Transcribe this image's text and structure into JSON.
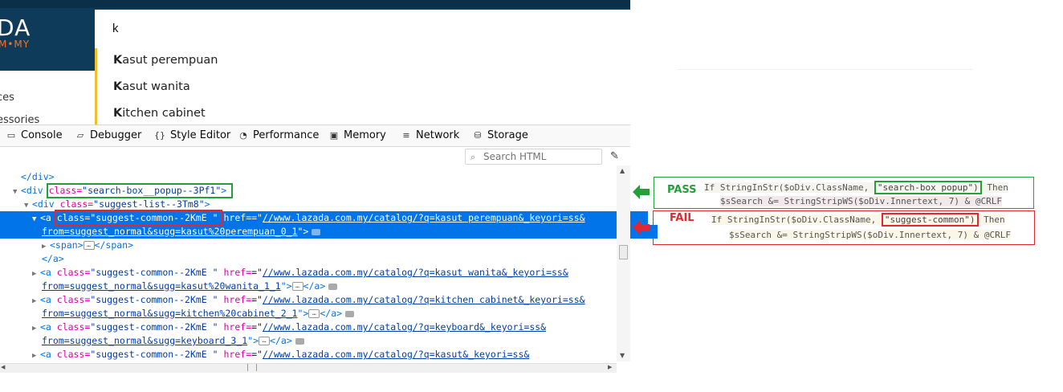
{
  "site": {
    "logo": "DA",
    "logo_sub": "M•MY",
    "categories": [
      "ces",
      "essories"
    ]
  },
  "search": {
    "value": "k",
    "suggestions": [
      {
        "hl": "K",
        "rest": "asut perempuan"
      },
      {
        "hl": "K",
        "rest": "asut wanita"
      },
      {
        "hl": "K",
        "rest": "itchen cabinet"
      }
    ]
  },
  "devtools": {
    "tabs": [
      {
        "icon": "console-icon",
        "label": "Console"
      },
      {
        "icon": "debugger-icon",
        "label": "Debugger"
      },
      {
        "icon": "style-editor-icon",
        "label": "Style Editor"
      },
      {
        "icon": "performance-icon",
        "label": "Performance"
      },
      {
        "icon": "memory-icon",
        "label": "Memory"
      },
      {
        "icon": "network-icon",
        "label": "Network"
      },
      {
        "icon": "storage-icon",
        "label": "Storage"
      }
    ],
    "search_placeholder": "Search HTML"
  },
  "markup": {
    "l0": "</div>",
    "l1_tag": "<div ",
    "l1_attr": "class=",
    "l1_val": "\"search-box__popup--3Pf1\"",
    "l1_end": ">",
    "l2_tag": "<div ",
    "l2_attr": "class=",
    "l2_val": "\"suggest-list--3Tm8\"",
    "l2_end": ">",
    "l3_tag": "<a ",
    "l3_attr": "class=",
    "l3_val": "\"suggest-common--2KmE \"",
    "l3_attr2": " href=",
    "l3_url": "//www.lazada.com.my/catalog/?q=kasut perempuan&_keyori=ss&",
    "l3b_url": "from=suggest_normal&sugg=kasut%20perempuan_0_1",
    "l3b_end": "\">",
    "l4": "<span>",
    "l4_end": "</span>",
    "l5": "</a>",
    "rows": [
      {
        "url": "//www.lazada.com.my/catalog/?q=kasut wanita&_keyori=ss&",
        "url2": "from=suggest_normal&sugg=kasut%20wanita_1_1"
      },
      {
        "url": "//www.lazada.com.my/catalog/?q=kitchen cabinet&_keyori=ss&",
        "url2": "from=suggest_normal&sugg=kitchen%20cabinet_2_1"
      },
      {
        "url": "//www.lazada.com.my/catalog/?q=keyboard&_keyori=ss&",
        "url2": "from=suggest_normal&sugg=keyboard_3_1"
      },
      {
        "url": "//www.lazada.com.my/catalog/?q=kasut&_keyori=ss&",
        "url2": ""
      }
    ],
    "row_tag": "<a ",
    "row_attr": "class=",
    "row_val": "\"suggest-common--2KmE \"",
    "row_attr2": " href=",
    "row_close": "</a>"
  },
  "annotations": {
    "pass": {
      "label": "PASS",
      "line1_a": "If StringInStr($oDiv.ClassName, ",
      "line1_box": "\"search-box  popup\")",
      "line1_b": " Then",
      "line2": "$sSearch &= StringStripWS($oDiv.Innertext, 7) & @CRLF",
      "color": "#22a13a"
    },
    "fail": {
      "label": "FAIL",
      "line1_a": "If StringInStr($oDiv.ClassName, ",
      "line1_box": "\"suggest-common\")",
      "line1_b": " Then",
      "line2": "$sSearch &= StringStripWS($oDiv.Innertext, 7) & @CRLF",
      "color": "#e0282e"
    }
  }
}
